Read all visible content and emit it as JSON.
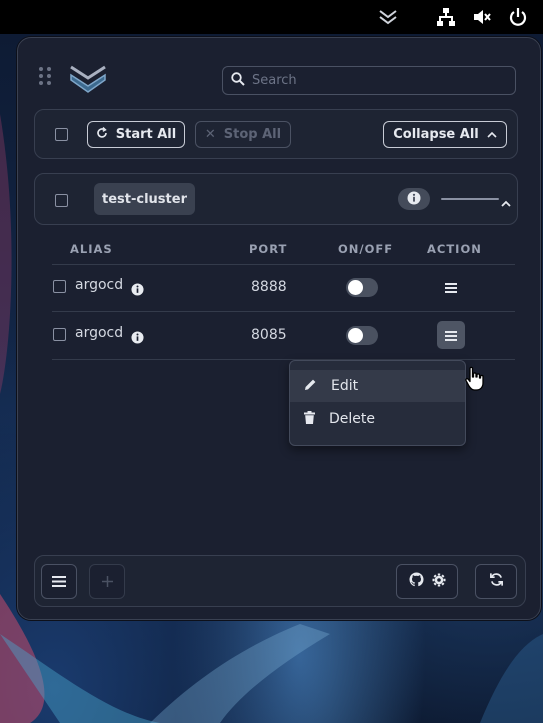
{
  "topbar": {
    "icons": [
      "collapse-chevrons-icon",
      "network-icon",
      "volume-muted-icon",
      "power-icon"
    ]
  },
  "panel": {
    "search_placeholder": "Search",
    "toolbar": {
      "start_all": "Start All",
      "stop_all": "Stop All",
      "collapse_all": "Collapse All"
    },
    "cluster": {
      "name": "test-cluster"
    },
    "table": {
      "headers": [
        "ALIAS",
        "PORT",
        "ON/OFF",
        "ACTION"
      ],
      "rows": [
        {
          "alias": "argocd",
          "port": "8888",
          "enabled": false
        },
        {
          "alias": "argocd",
          "port": "8085",
          "enabled": false
        }
      ]
    },
    "action_menu": {
      "items": [
        {
          "label": "Edit",
          "icon": "pencil-icon"
        },
        {
          "label": "Delete",
          "icon": "trash-icon"
        }
      ]
    },
    "footer": {
      "buttons": [
        "menu-icon",
        "plus-icon",
        "github-icon",
        "gear-icon",
        "refresh-icon"
      ]
    }
  },
  "colors": {
    "panel_bg": "#1b2030",
    "border": "#3a4152",
    "tag_bg": "#3a4150",
    "toggle_off": "#4a5160"
  }
}
